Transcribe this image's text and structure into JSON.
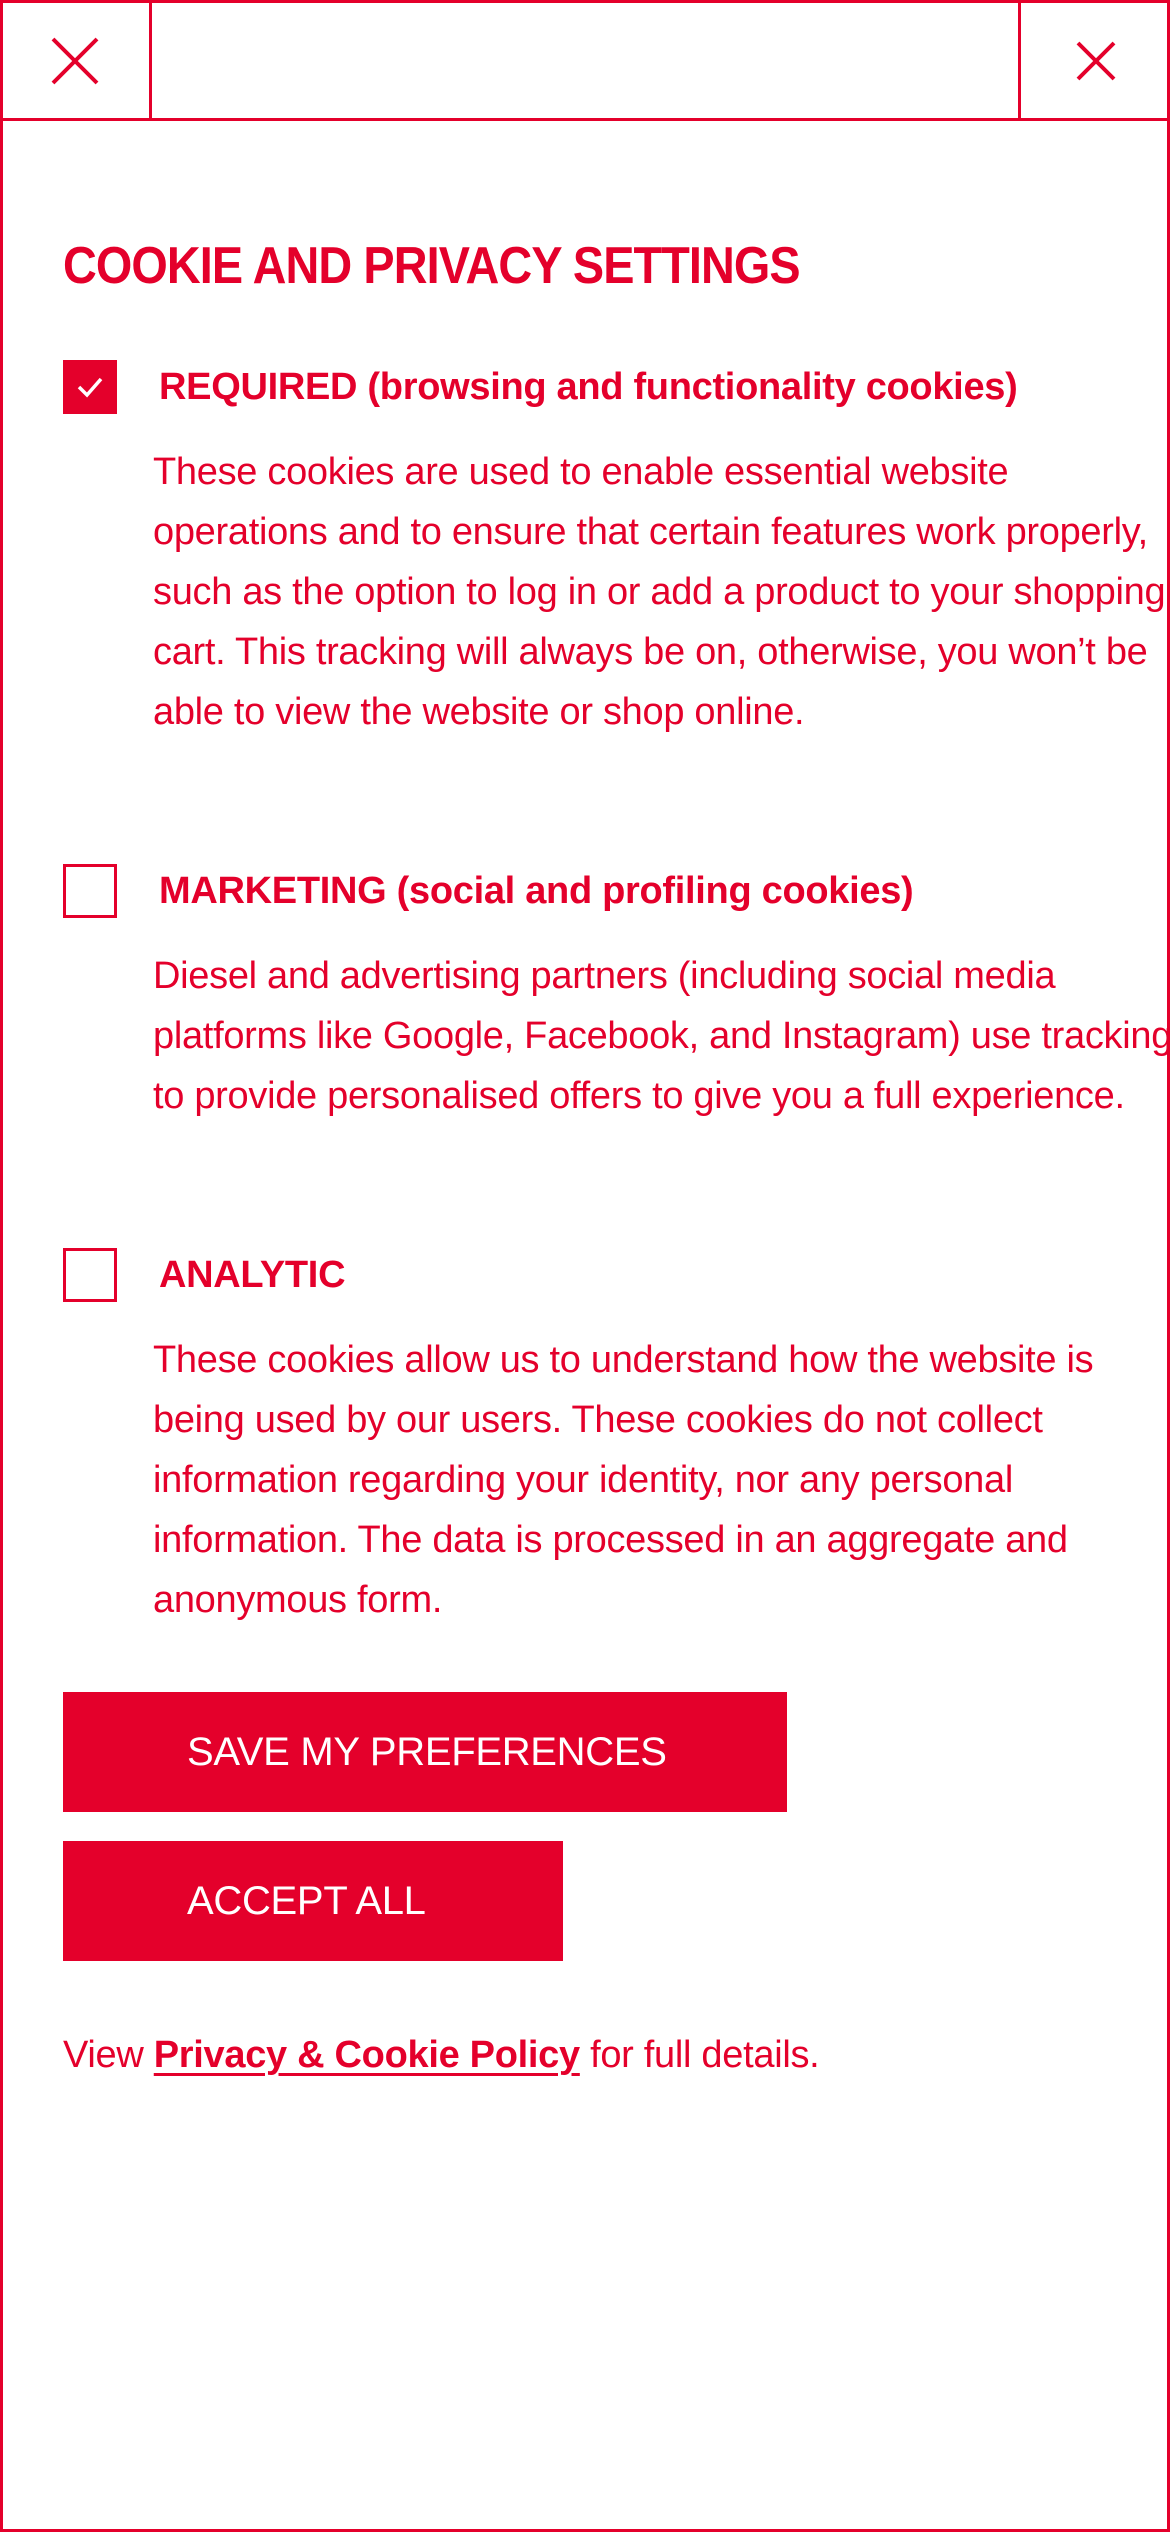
{
  "colors": {
    "accent": "#e4002b",
    "background": "#ffffff",
    "button_text": "#ffffff"
  },
  "header": {
    "left_icon": "close-icon",
    "right_icon": "close-icon"
  },
  "title": "COOKIE AND PRIVACY SETTINGS",
  "options": [
    {
      "checked": true,
      "label": "REQUIRED (browsing and functionality cookies)",
      "description": "These cookies are used to enable essential website operations and to ensure that certain features work properly, such as the option to log in or add a product to your shopping cart. This tracking will always be on, otherwise, you won’t be able to view the website or shop online."
    },
    {
      "checked": false,
      "label": "MARKETING (social and profiling cookies)",
      "description": "Diesel and advertising partners (including social media platforms like Google, Facebook, and Instagram) use tracking to provide personalised offers to give you a full experience."
    },
    {
      "checked": false,
      "label": "ANALYTIC",
      "description": "These cookies allow us to understand how the website is being used by our users. These cookies do not collect information regarding your identity, nor any personal information. The data is processed in an aggregate and anonymous form."
    }
  ],
  "buttons": {
    "save": "SAVE MY PREFERENCES",
    "accept_all": "ACCEPT ALL"
  },
  "footer": {
    "prefix": "View",
    "link": "Privacy & Cookie Policy",
    "suffix": "for full details."
  }
}
